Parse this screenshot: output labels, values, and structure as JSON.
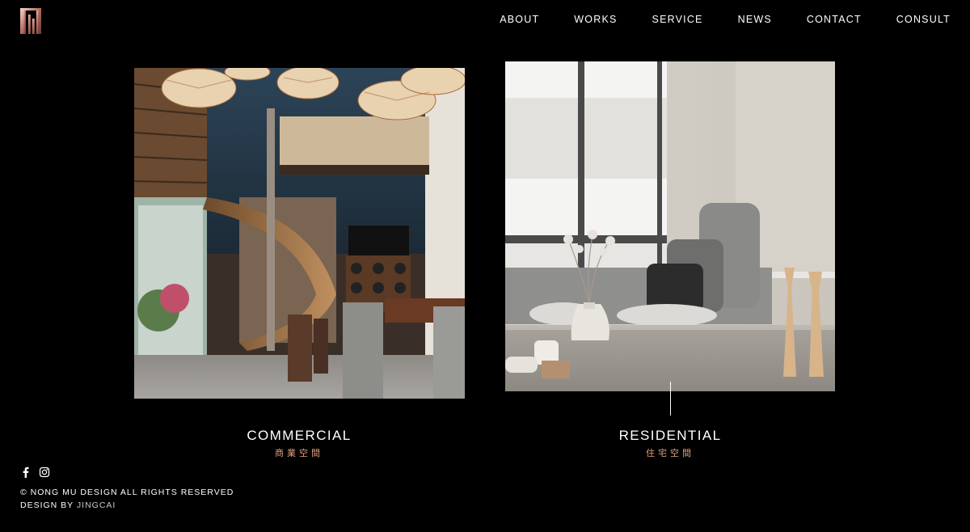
{
  "nav": {
    "items": [
      {
        "label": "ABOUT"
      },
      {
        "label": "WORKS"
      },
      {
        "label": "SERVICE"
      },
      {
        "label": "NEWS"
      },
      {
        "label": "CONTACT"
      },
      {
        "label": "CONSULT"
      }
    ]
  },
  "cards": [
    {
      "title": "COMMERCIAL",
      "subtitle": "商業空間"
    },
    {
      "title": "RESIDENTIAL",
      "subtitle": "住宅空間"
    }
  ],
  "footer": {
    "social": [
      {
        "icon": "facebook-icon"
      },
      {
        "icon": "instagram-icon"
      }
    ],
    "copyright": "© NONG MU DESIGN ALL RIGHTS RESERVED",
    "credit_prefix": "DESIGN BY ",
    "credit_link": "JINGCAI"
  },
  "colors": {
    "background": "#000000",
    "accent": "#e2a27a"
  }
}
